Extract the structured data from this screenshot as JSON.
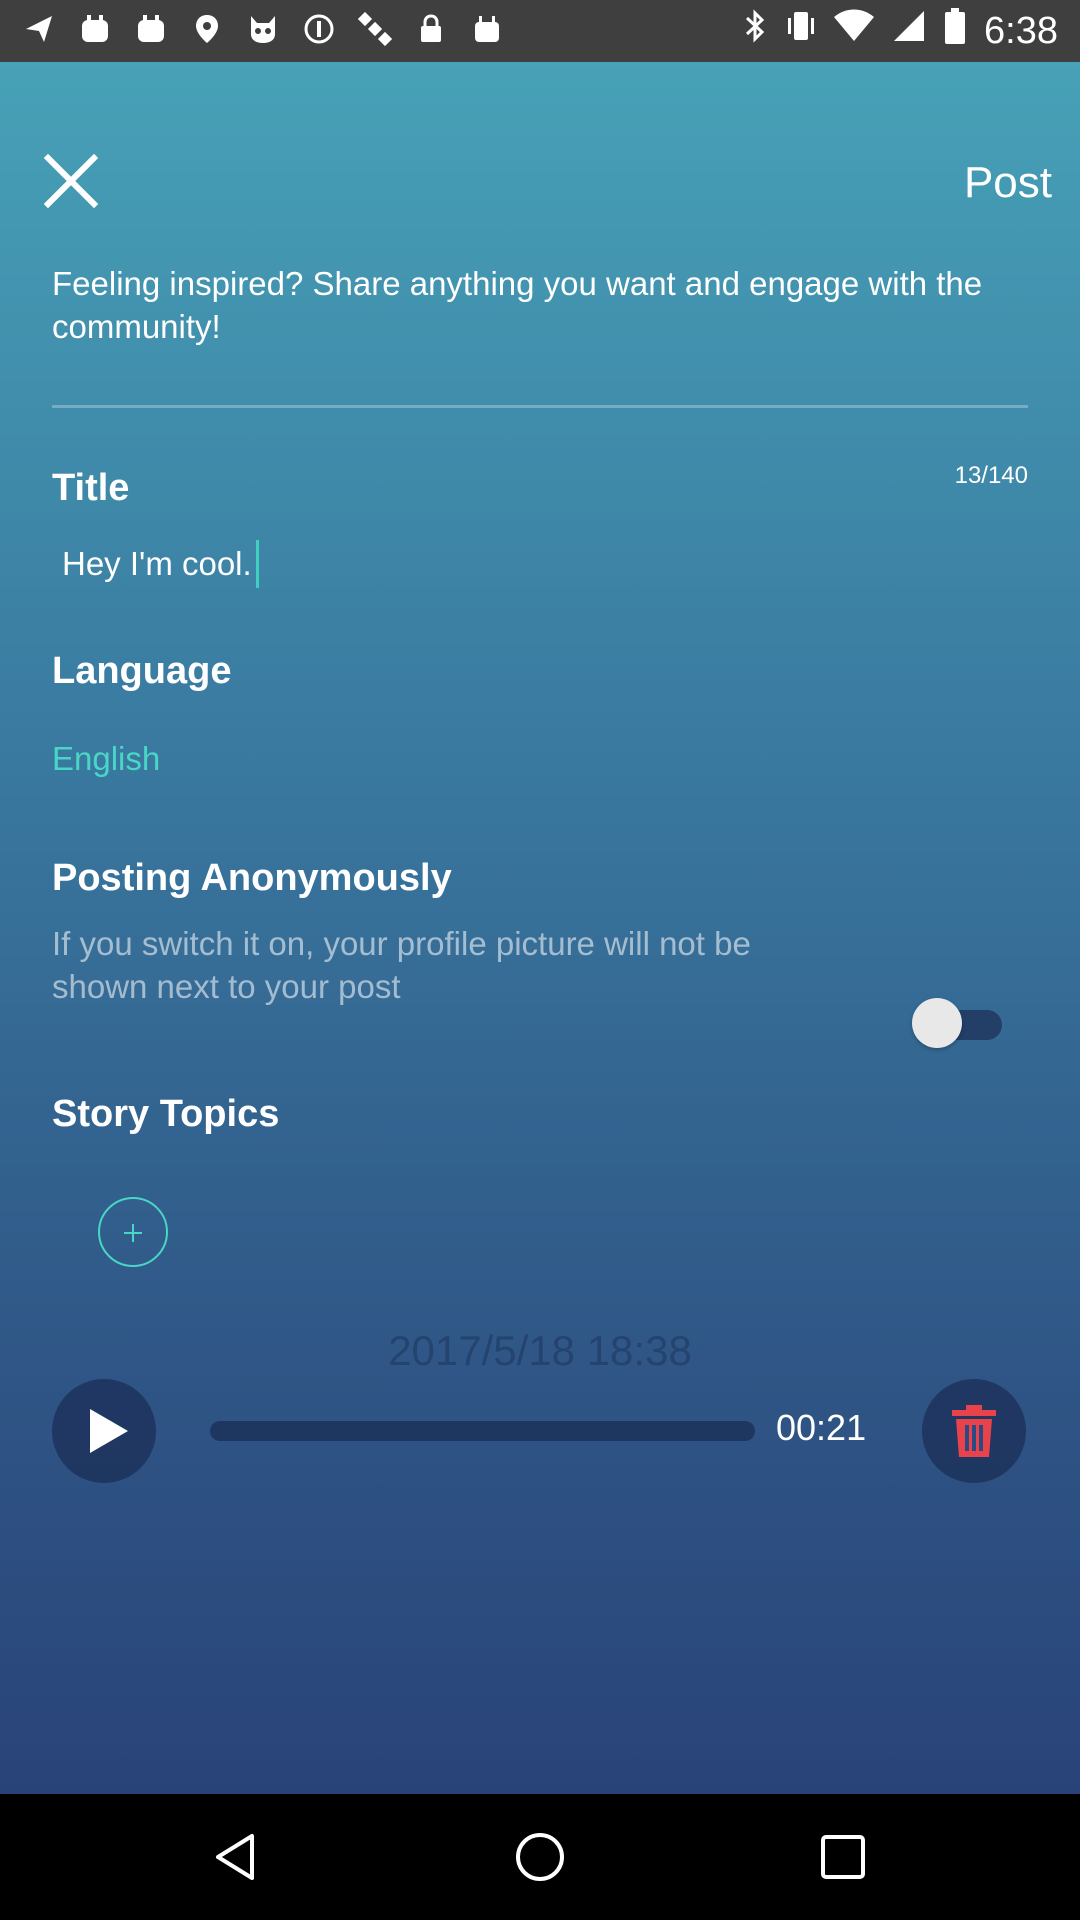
{
  "status_bar": {
    "time": "6:38",
    "left_icons": [
      "navigation-icon",
      "recorder-icon",
      "recorder-icon",
      "fake-gps-icon",
      "cat-icon",
      "info-icon",
      "satellite-icon",
      "lock-icon",
      "android-icon"
    ],
    "right_icons": [
      "bluetooth-icon",
      "vibrate-icon",
      "wifi-icon",
      "signal-icon",
      "battery-icon"
    ]
  },
  "header": {
    "close_icon": "close-icon",
    "post_label": "Post"
  },
  "intro": {
    "text": "Feeling inspired? Share anything you want and engage with the community!"
  },
  "title_section": {
    "label": "Title",
    "counter": "13/140",
    "value": "Hey I'm cool."
  },
  "language_section": {
    "label": "Language",
    "value": "English"
  },
  "anonymous_section": {
    "label": "Posting Anonymously",
    "description": "If you switch it on, your profile picture will not be shown next to your post",
    "enabled": false
  },
  "topics_section": {
    "label": "Story Topics",
    "add_icon": "plus-icon"
  },
  "recording": {
    "date": "2017/5/18 18:38",
    "duration": "00:21",
    "progress": 0.0,
    "play_icon": "play-icon",
    "delete_icon": "trash-icon"
  },
  "colors": {
    "accent": "#49d6c6",
    "delete": "#e8434a",
    "gradient_top": "#47a1b7",
    "gradient_bottom": "#294378"
  },
  "nav_bar": {
    "back_icon": "back-icon",
    "home_icon": "home-icon",
    "recents_icon": "recents-icon"
  }
}
